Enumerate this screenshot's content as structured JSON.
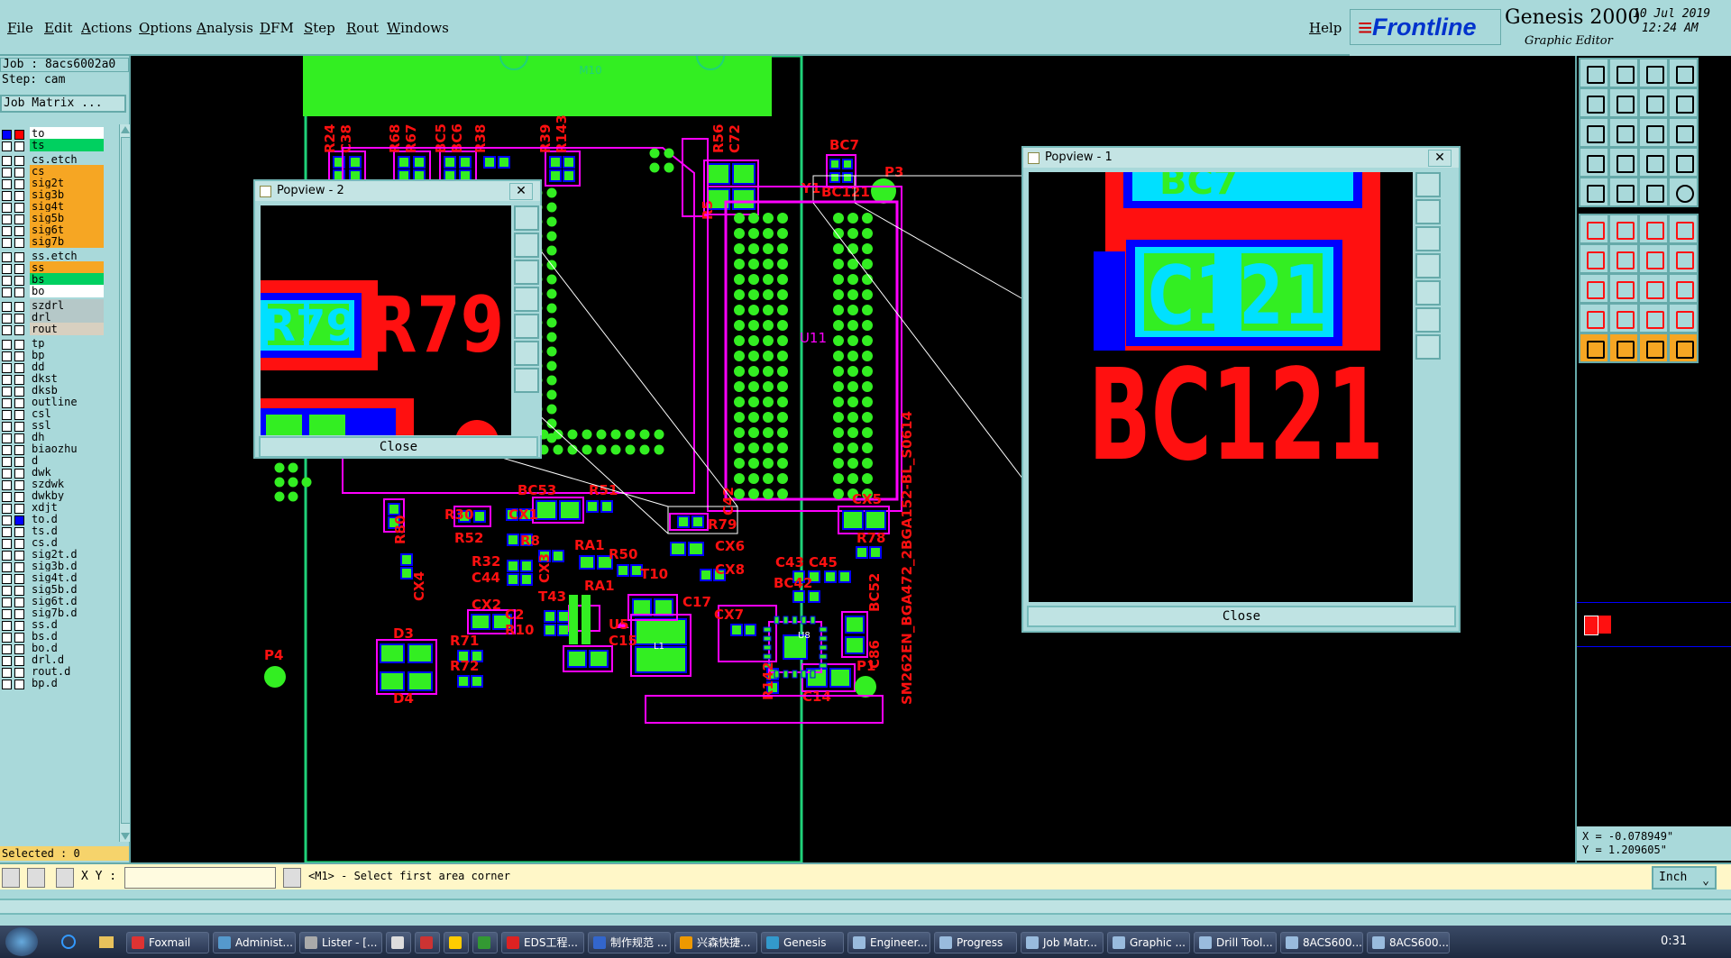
{
  "menu": [
    "File",
    "Edit",
    "Actions",
    "Options",
    "Analysis",
    "DFM",
    "Step",
    "Rout",
    "Windows"
  ],
  "help_label": "Help",
  "brand": {
    "logo": "Frontline",
    "product": "Genesis 2000",
    "subtitle": "Graphic Editor",
    "date": "10 Jul 2019",
    "time": "12:24 AM"
  },
  "job": {
    "job_label": "Job : 8acs6002a0",
    "step_label": "Step: cam",
    "matrix_button": "Job Matrix ..."
  },
  "layers": [
    {
      "name": "to",
      "bg": "#ffffff",
      "c1": "#0000ff",
      "c2": "#ff0000",
      "flag": "■■"
    },
    {
      "name": "ts",
      "bg": "#00d060",
      "flag": "■■"
    },
    {
      "name": "cs.etch",
      "bg": "#a9d9da",
      "sep": true
    },
    {
      "name": "cs",
      "bg": "#f6a623",
      "flag": "⬏"
    },
    {
      "name": "sig2t",
      "bg": "#f6a623",
      "flag": "⬏"
    },
    {
      "name": "sig3b",
      "bg": "#f6a623",
      "flag": "⬏"
    },
    {
      "name": "sig4t",
      "bg": "#f6a623",
      "flag": "⬏"
    },
    {
      "name": "sig5b",
      "bg": "#f6a623",
      "flag": "⬏"
    },
    {
      "name": "sig6t",
      "bg": "#f6a623",
      "flag": "⬏"
    },
    {
      "name": "sig7b",
      "bg": "#f6a623",
      "flag": "⬏"
    },
    {
      "name": "ss.etch",
      "bg": "#a9d9da",
      "sep": true
    },
    {
      "name": "ss",
      "bg": "#f6a623",
      "flag": "⬏"
    },
    {
      "name": "bs",
      "bg": "#00d060",
      "flag": "⬏"
    },
    {
      "name": "bo",
      "bg": "#ffffff",
      "flag": "⬏"
    },
    {
      "name": "szdrl",
      "bg": "#b5c8c8",
      "sep": true
    },
    {
      "name": "drl",
      "bg": "#b5c8c8"
    },
    {
      "name": "rout",
      "bg": "#d8d0c0"
    },
    {
      "name": "tp",
      "bg": "#a9d9da",
      "sep": true
    },
    {
      "name": "bp",
      "bg": "#a9d9da"
    },
    {
      "name": "dd",
      "bg": "#a9d9da"
    },
    {
      "name": "dkst",
      "bg": "#a9d9da"
    },
    {
      "name": "dksb",
      "bg": "#a9d9da"
    },
    {
      "name": "outline",
      "bg": "#a9d9da"
    },
    {
      "name": "csl",
      "bg": "#a9d9da"
    },
    {
      "name": "ssl",
      "bg": "#a9d9da"
    },
    {
      "name": "dh",
      "bg": "#a9d9da"
    },
    {
      "name": "biaozhu",
      "bg": "#a9d9da"
    },
    {
      "name": "d",
      "bg": "#a9d9da"
    },
    {
      "name": "dwk",
      "bg": "#a9d9da"
    },
    {
      "name": "szdwk",
      "bg": "#a9d9da"
    },
    {
      "name": "dwkby",
      "bg": "#a9d9da"
    },
    {
      "name": "xdjt",
      "bg": "#a9d9da"
    },
    {
      "name": "to.d",
      "bg": "#a9d9da",
      "c2": "#0000ff",
      "flag": "⬏"
    },
    {
      "name": "ts.d",
      "bg": "#a9d9da",
      "flag": "⬏"
    },
    {
      "name": "cs.d",
      "bg": "#a9d9da",
      "flag": "⬏"
    },
    {
      "name": "sig2t.d",
      "bg": "#a9d9da",
      "flag": "⬏"
    },
    {
      "name": "sig3b.d",
      "bg": "#a9d9da",
      "flag": "⬏"
    },
    {
      "name": "sig4t.d",
      "bg": "#a9d9da",
      "flag": "⬏"
    },
    {
      "name": "sig5b.d",
      "bg": "#a9d9da",
      "flag": "⬏"
    },
    {
      "name": "sig6t.d",
      "bg": "#a9d9da",
      "flag": "⬏"
    },
    {
      "name": "sig7b.d",
      "bg": "#a9d9da",
      "flag": "⬏"
    },
    {
      "name": "ss.d",
      "bg": "#a9d9da",
      "flag": "⬏"
    },
    {
      "name": "bs.d",
      "bg": "#a9d9da",
      "flag": "⬏"
    },
    {
      "name": "bo.d",
      "bg": "#a9d9da",
      "flag": "⬏"
    },
    {
      "name": "drl.d",
      "bg": "#a9d9da"
    },
    {
      "name": "rout.d",
      "bg": "#a9d9da"
    },
    {
      "name": "bp.d",
      "bg": "#a9d9da"
    }
  ],
  "selected": "Selected : 0",
  "popview1": {
    "title": "Popview - 1",
    "close": "Close",
    "labels": [
      "BC121",
      "C121",
      "BC7"
    ]
  },
  "popview2": {
    "title": "Popview - 2",
    "close": "Close",
    "labels": [
      "R79",
      "R79"
    ]
  },
  "board_labels": {
    "m10": "M10",
    "u11": "U11",
    "y1": "Y1",
    "p3": "P3",
    "bc7": "BC7",
    "bc121": "BC121",
    "r24": "R24",
    "c38": "C38",
    "r68": "R68",
    "r67": "R67",
    "bc5": "BC5",
    "bc6": "BC6",
    "r38": "R38",
    "r39": "R39",
    "r143": "R143",
    "r56": "R56",
    "c72": "C72",
    "r5": "R5",
    "c42": "C42",
    "r30": "R30",
    "bc53": "BC53",
    "r51": "R51",
    "cx1": "CX1",
    "r79": "R79",
    "r80": "R80",
    "r52": "R52",
    "r8": "R8",
    "ra1": "RA1",
    "cx6": "CX6",
    "cx5": "CX5",
    "r78": "R78",
    "cx4": "CX4",
    "r32": "R32",
    "c44": "C44",
    "cx3": "CX3",
    "r50": "R50",
    "cx8": "CX8",
    "t10": "T10",
    "ra1b": "RA1",
    "c43": "C43",
    "c45": "C45",
    "bc42": "BC42",
    "cx2": "CX2",
    "c2": "C2",
    "r10": "R10",
    "t43": "T43",
    "c17": "C17",
    "u5": "U5",
    "cx7": "CX7",
    "u8": "U8",
    "bc52": "BC52",
    "c86": "C86",
    "c15": "C15",
    "l1": "L1",
    "d3": "D3",
    "r71": "R71",
    "r72": "R72",
    "d4": "D4",
    "p4": "P4",
    "r142": "R142",
    "c14": "C14",
    "p1": "P1",
    "vtext": "SM262EN_BGA472_2BGA152-BL_S0614"
  },
  "coords": {
    "x": "X = -0.078949\"",
    "y": "Y = 1.209605\""
  },
  "xy_label": "X Y :",
  "xy_value": "",
  "status_message": "<M1> - Select first area corner",
  "units": "Inch",
  "taskbar": {
    "items": [
      {
        "label": "Foxmail",
        "color": "#d33"
      },
      {
        "label": "Administ...",
        "color": "#59c"
      },
      {
        "label": "Lister - [...",
        "color": "#aaa"
      },
      {
        "label": "",
        "color": "#ddd"
      },
      {
        "label": "",
        "color": "#c33"
      },
      {
        "label": "",
        "color": "#fc0"
      },
      {
        "label": "",
        "color": "#393"
      },
      {
        "label": "EDS工程...",
        "color": "#d22"
      },
      {
        "label": "制作规范 ...",
        "color": "#36c"
      },
      {
        "label": "兴森快捷...",
        "color": "#e90"
      },
      {
        "label": "Genesis",
        "color": "#39c"
      },
      {
        "label": "Engineer...",
        "color": "#9bd"
      },
      {
        "label": "Progress",
        "color": "#9bd"
      },
      {
        "label": "Job Matr...",
        "color": "#9bd"
      },
      {
        "label": "Graphic ...",
        "color": "#9bd"
      },
      {
        "label": "Drill Tool...",
        "color": "#9bd"
      },
      {
        "label": "8ACS600...",
        "color": "#9bd"
      },
      {
        "label": "8ACS600...",
        "color": "#9bd"
      }
    ],
    "clock": "0:31"
  }
}
